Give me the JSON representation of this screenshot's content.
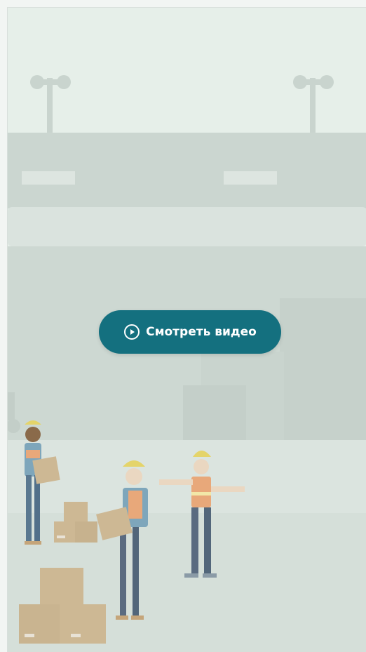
{
  "video_cta": {
    "label": "Смотреть видео",
    "icon": "play-circle-icon"
  },
  "colors": {
    "button_bg": "#14707f",
    "button_text": "#ffffff",
    "sky": "#e6efe9",
    "warehouse": "#cdd8d2",
    "floor": "#dde6e1"
  }
}
